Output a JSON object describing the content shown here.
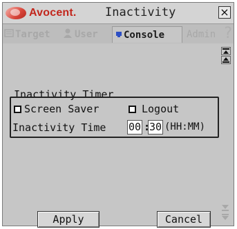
{
  "window": {
    "brand": "Avocent.",
    "title": "Inactivity",
    "close_glyph": "×"
  },
  "tabs": [
    {
      "label": "Target",
      "icon": "target-icon",
      "active": false
    },
    {
      "label": "User",
      "icon": "user-icon",
      "active": false
    },
    {
      "label": "Console",
      "icon": "console-icon",
      "active": true
    },
    {
      "label": "Admin",
      "icon": "",
      "active": false
    }
  ],
  "help_glyph": "?",
  "inactivity_timer": {
    "legend": "Inactivity Timer",
    "screen_saver_label": "Screen Saver",
    "screen_saver_checked": false,
    "logout_label": "Logout",
    "logout_checked": false,
    "time_label": "Inactivity Time",
    "hours": "00",
    "colon": ":",
    "minutes": "30",
    "format_hint": "(HH:MM)"
  },
  "buttons": {
    "apply": "Apply",
    "cancel": "Cancel"
  },
  "colors": {
    "brand": "#c2261c",
    "panel": "#c6c6c6",
    "inactive_tab": "#a8a8a8"
  }
}
